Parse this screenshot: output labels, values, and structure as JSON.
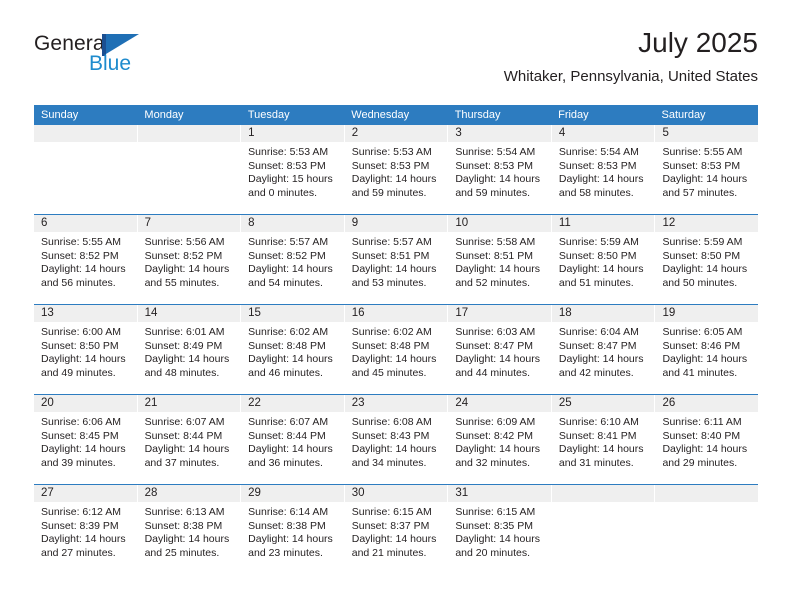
{
  "brand": {
    "name_part1": "General",
    "name_part2": "Blue",
    "logo_icon": "general-blue-flag-logo",
    "color_dark": "#231f20",
    "color_blue": "#1e8bcd"
  },
  "header": {
    "month_title": "July 2025",
    "location": "Whitaker, Pennsylvania, United States"
  },
  "calendar": {
    "accent_color": "#2d7cc0",
    "daynum_band_color": "#efefef",
    "weekday_headers": [
      "Sunday",
      "Monday",
      "Tuesday",
      "Wednesday",
      "Thursday",
      "Friday",
      "Saturday"
    ],
    "weeks": [
      [
        {
          "day": ""
        },
        {
          "day": ""
        },
        {
          "day": "1",
          "sunrise": "Sunrise: 5:53 AM",
          "sunset": "Sunset: 8:53 PM",
          "daylight1": "Daylight: 15 hours",
          "daylight2": "and 0 minutes."
        },
        {
          "day": "2",
          "sunrise": "Sunrise: 5:53 AM",
          "sunset": "Sunset: 8:53 PM",
          "daylight1": "Daylight: 14 hours",
          "daylight2": "and 59 minutes."
        },
        {
          "day": "3",
          "sunrise": "Sunrise: 5:54 AM",
          "sunset": "Sunset: 8:53 PM",
          "daylight1": "Daylight: 14 hours",
          "daylight2": "and 59 minutes."
        },
        {
          "day": "4",
          "sunrise": "Sunrise: 5:54 AM",
          "sunset": "Sunset: 8:53 PM",
          "daylight1": "Daylight: 14 hours",
          "daylight2": "and 58 minutes."
        },
        {
          "day": "5",
          "sunrise": "Sunrise: 5:55 AM",
          "sunset": "Sunset: 8:53 PM",
          "daylight1": "Daylight: 14 hours",
          "daylight2": "and 57 minutes."
        }
      ],
      [
        {
          "day": "6",
          "sunrise": "Sunrise: 5:55 AM",
          "sunset": "Sunset: 8:52 PM",
          "daylight1": "Daylight: 14 hours",
          "daylight2": "and 56 minutes."
        },
        {
          "day": "7",
          "sunrise": "Sunrise: 5:56 AM",
          "sunset": "Sunset: 8:52 PM",
          "daylight1": "Daylight: 14 hours",
          "daylight2": "and 55 minutes."
        },
        {
          "day": "8",
          "sunrise": "Sunrise: 5:57 AM",
          "sunset": "Sunset: 8:52 PM",
          "daylight1": "Daylight: 14 hours",
          "daylight2": "and 54 minutes."
        },
        {
          "day": "9",
          "sunrise": "Sunrise: 5:57 AM",
          "sunset": "Sunset: 8:51 PM",
          "daylight1": "Daylight: 14 hours",
          "daylight2": "and 53 minutes."
        },
        {
          "day": "10",
          "sunrise": "Sunrise: 5:58 AM",
          "sunset": "Sunset: 8:51 PM",
          "daylight1": "Daylight: 14 hours",
          "daylight2": "and 52 minutes."
        },
        {
          "day": "11",
          "sunrise": "Sunrise: 5:59 AM",
          "sunset": "Sunset: 8:50 PM",
          "daylight1": "Daylight: 14 hours",
          "daylight2": "and 51 minutes."
        },
        {
          "day": "12",
          "sunrise": "Sunrise: 5:59 AM",
          "sunset": "Sunset: 8:50 PM",
          "daylight1": "Daylight: 14 hours",
          "daylight2": "and 50 minutes."
        }
      ],
      [
        {
          "day": "13",
          "sunrise": "Sunrise: 6:00 AM",
          "sunset": "Sunset: 8:50 PM",
          "daylight1": "Daylight: 14 hours",
          "daylight2": "and 49 minutes."
        },
        {
          "day": "14",
          "sunrise": "Sunrise: 6:01 AM",
          "sunset": "Sunset: 8:49 PM",
          "daylight1": "Daylight: 14 hours",
          "daylight2": "and 48 minutes."
        },
        {
          "day": "15",
          "sunrise": "Sunrise: 6:02 AM",
          "sunset": "Sunset: 8:48 PM",
          "daylight1": "Daylight: 14 hours",
          "daylight2": "and 46 minutes."
        },
        {
          "day": "16",
          "sunrise": "Sunrise: 6:02 AM",
          "sunset": "Sunset: 8:48 PM",
          "daylight1": "Daylight: 14 hours",
          "daylight2": "and 45 minutes."
        },
        {
          "day": "17",
          "sunrise": "Sunrise: 6:03 AM",
          "sunset": "Sunset: 8:47 PM",
          "daylight1": "Daylight: 14 hours",
          "daylight2": "and 44 minutes."
        },
        {
          "day": "18",
          "sunrise": "Sunrise: 6:04 AM",
          "sunset": "Sunset: 8:47 PM",
          "daylight1": "Daylight: 14 hours",
          "daylight2": "and 42 minutes."
        },
        {
          "day": "19",
          "sunrise": "Sunrise: 6:05 AM",
          "sunset": "Sunset: 8:46 PM",
          "daylight1": "Daylight: 14 hours",
          "daylight2": "and 41 minutes."
        }
      ],
      [
        {
          "day": "20",
          "sunrise": "Sunrise: 6:06 AM",
          "sunset": "Sunset: 8:45 PM",
          "daylight1": "Daylight: 14 hours",
          "daylight2": "and 39 minutes."
        },
        {
          "day": "21",
          "sunrise": "Sunrise: 6:07 AM",
          "sunset": "Sunset: 8:44 PM",
          "daylight1": "Daylight: 14 hours",
          "daylight2": "and 37 minutes."
        },
        {
          "day": "22",
          "sunrise": "Sunrise: 6:07 AM",
          "sunset": "Sunset: 8:44 PM",
          "daylight1": "Daylight: 14 hours",
          "daylight2": "and 36 minutes."
        },
        {
          "day": "23",
          "sunrise": "Sunrise: 6:08 AM",
          "sunset": "Sunset: 8:43 PM",
          "daylight1": "Daylight: 14 hours",
          "daylight2": "and 34 minutes."
        },
        {
          "day": "24",
          "sunrise": "Sunrise: 6:09 AM",
          "sunset": "Sunset: 8:42 PM",
          "daylight1": "Daylight: 14 hours",
          "daylight2": "and 32 minutes."
        },
        {
          "day": "25",
          "sunrise": "Sunrise: 6:10 AM",
          "sunset": "Sunset: 8:41 PM",
          "daylight1": "Daylight: 14 hours",
          "daylight2": "and 31 minutes."
        },
        {
          "day": "26",
          "sunrise": "Sunrise: 6:11 AM",
          "sunset": "Sunset: 8:40 PM",
          "daylight1": "Daylight: 14 hours",
          "daylight2": "and 29 minutes."
        }
      ],
      [
        {
          "day": "27",
          "sunrise": "Sunrise: 6:12 AM",
          "sunset": "Sunset: 8:39 PM",
          "daylight1": "Daylight: 14 hours",
          "daylight2": "and 27 minutes."
        },
        {
          "day": "28",
          "sunrise": "Sunrise: 6:13 AM",
          "sunset": "Sunset: 8:38 PM",
          "daylight1": "Daylight: 14 hours",
          "daylight2": "and 25 minutes."
        },
        {
          "day": "29",
          "sunrise": "Sunrise: 6:14 AM",
          "sunset": "Sunset: 8:38 PM",
          "daylight1": "Daylight: 14 hours",
          "daylight2": "and 23 minutes."
        },
        {
          "day": "30",
          "sunrise": "Sunrise: 6:15 AM",
          "sunset": "Sunset: 8:37 PM",
          "daylight1": "Daylight: 14 hours",
          "daylight2": "and 21 minutes."
        },
        {
          "day": "31",
          "sunrise": "Sunrise: 6:15 AM",
          "sunset": "Sunset: 8:35 PM",
          "daylight1": "Daylight: 14 hours",
          "daylight2": "and 20 minutes."
        },
        {
          "day": ""
        },
        {
          "day": ""
        }
      ]
    ]
  }
}
